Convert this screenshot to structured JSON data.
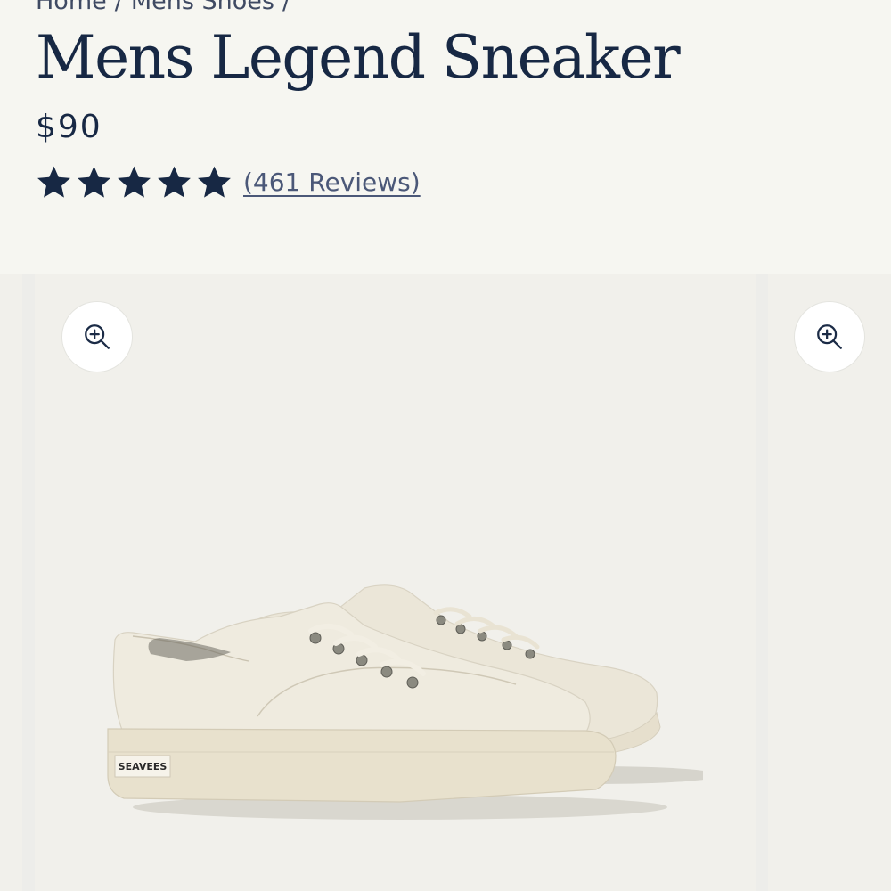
{
  "breadcrumb": {
    "items": [
      "Home",
      "Mens Shoes"
    ],
    "separator": "/"
  },
  "product": {
    "title": "Mens Legend Sneaker",
    "price": "$90",
    "rating": 5,
    "reviews_label": "(461 Reviews)",
    "brand_mark": "SEAVEES"
  },
  "gallery": {
    "zoom_icon": "zoom-in-icon"
  },
  "colors": {
    "text_primary": "#172844",
    "background": "#f6f6f1",
    "gallery_background": "#f1f0eb"
  }
}
